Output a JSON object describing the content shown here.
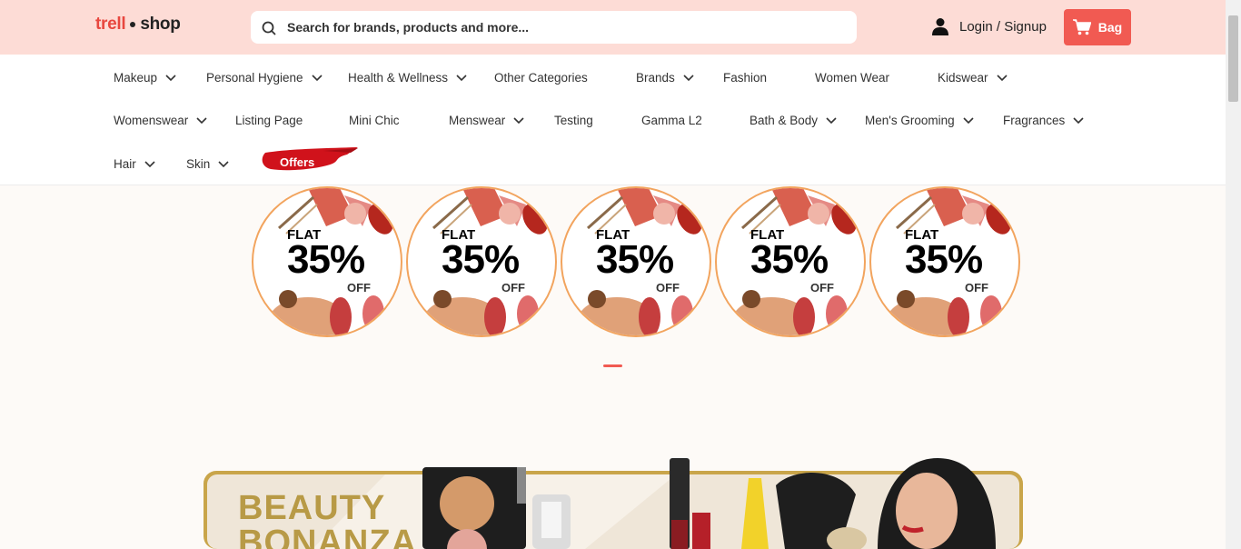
{
  "header": {
    "logo_left": "trell",
    "logo_right": "shop",
    "search_placeholder": "Search for brands, products and more...",
    "login_label": "Login / Signup",
    "bag_label": "Bag"
  },
  "nav": {
    "items": [
      {
        "label": "Makeup",
        "has_dropdown": true
      },
      {
        "label": "Personal Hygiene",
        "has_dropdown": true
      },
      {
        "label": "Health & Wellness",
        "has_dropdown": true
      },
      {
        "label": "Other Categories",
        "has_dropdown": false
      },
      {
        "label": "Brands",
        "has_dropdown": true
      },
      {
        "label": "Fashion",
        "has_dropdown": false
      },
      {
        "label": "Women Wear",
        "has_dropdown": false
      },
      {
        "label": "Kidswear",
        "has_dropdown": true
      },
      {
        "label": "Womenswear",
        "has_dropdown": true
      },
      {
        "label": "Listing Page",
        "has_dropdown": false
      },
      {
        "label": "Mini Chic",
        "has_dropdown": false
      },
      {
        "label": "Menswear",
        "has_dropdown": true
      },
      {
        "label": "Testing",
        "has_dropdown": false
      },
      {
        "label": "Gamma L2",
        "has_dropdown": false
      },
      {
        "label": "Bath & Body",
        "has_dropdown": true
      },
      {
        "label": "Men's Grooming",
        "has_dropdown": true
      },
      {
        "label": "Fragrances",
        "has_dropdown": true
      },
      {
        "label": "Hair",
        "has_dropdown": true
      },
      {
        "label": "Skin",
        "has_dropdown": true
      }
    ],
    "offers_label": "Offers"
  },
  "promos": {
    "items": [
      {
        "flat": "FLAT",
        "pct": "35%",
        "off": "OFF"
      },
      {
        "flat": "FLAT",
        "pct": "35%",
        "off": "OFF"
      },
      {
        "flat": "FLAT",
        "pct": "35%",
        "off": "OFF"
      },
      {
        "flat": "FLAT",
        "pct": "35%",
        "off": "OFF"
      },
      {
        "flat": "FLAT",
        "pct": "35%",
        "off": "OFF"
      }
    ]
  },
  "banner": {
    "line1": "BEAUTY",
    "line2": "BONANZA"
  },
  "colors": {
    "header_bg": "#fddcd6",
    "accent": "#f15a52",
    "promo_border": "#f2a45e"
  }
}
